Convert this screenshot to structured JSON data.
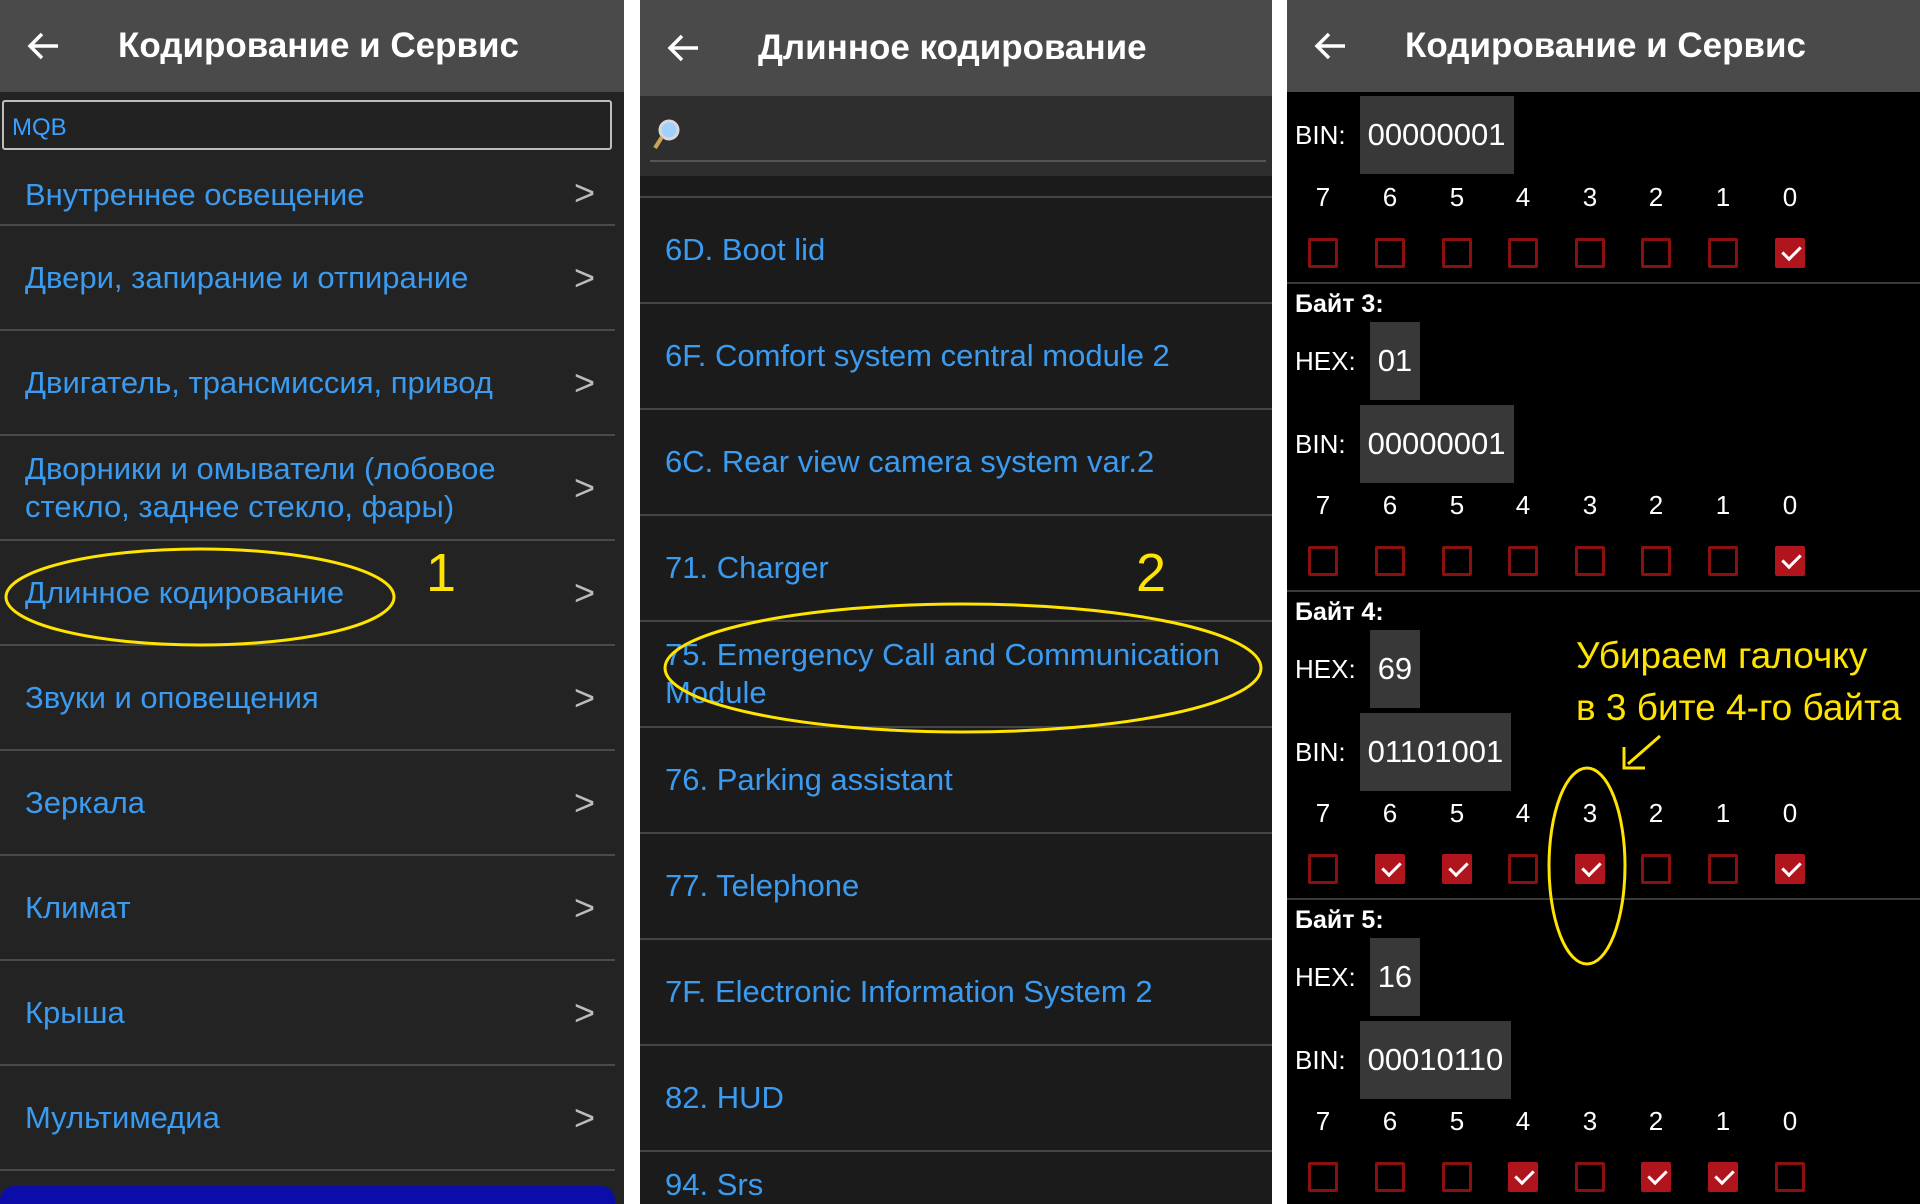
{
  "panel1": {
    "title": "Кодирование и Сервис",
    "filter_value": "MQB",
    "items": [
      "Внутреннее освещение",
      "Двери, запирание и отпирание",
      "Двигатель, трансмиссия, привод",
      "Дворники и омыватели (лобовое стекло, заднее стекло, фары)",
      "Длинное кодирование",
      "Звуки и оповещения",
      "Зеркала",
      "Климат",
      "Крыша",
      "Мультимедиа"
    ],
    "chevron": ">"
  },
  "panel2": {
    "title": "Длинное кодирование",
    "items": [
      "6D. Boot lid",
      "6F. Comfort system central module 2",
      "6C. Rear view camera system var.2",
      "71. Charger",
      "75. Emergency Call and Communication Module",
      "76. Parking assistant",
      "77. Telephone",
      "7F. Electronic Information System 2",
      "82. HUD",
      "94. Srs"
    ]
  },
  "panel3": {
    "title": "Кодирование и Сервис",
    "hex_label": "HEX:",
    "bin_label": "BIN:",
    "bit_numbers": [
      "7",
      "6",
      "5",
      "4",
      "3",
      "2",
      "1",
      "0"
    ],
    "byte2": {
      "bin": "00000001",
      "bits": [
        false,
        false,
        false,
        false,
        false,
        false,
        false,
        true
      ]
    },
    "byte3": {
      "label": "Байт 3:",
      "hex": "01",
      "bin": "00000001",
      "bits": [
        false,
        false,
        false,
        false,
        false,
        false,
        false,
        true
      ]
    },
    "byte4": {
      "label": "Байт 4:",
      "hex": "69",
      "bin": "01101001",
      "bits": [
        false,
        true,
        true,
        false,
        true,
        false,
        false,
        true
      ]
    },
    "byte5": {
      "label": "Байт 5:",
      "hex": "16",
      "bin": "00010110",
      "bits": [
        false,
        false,
        false,
        true,
        false,
        true,
        true,
        false
      ]
    }
  },
  "annotations": {
    "marker1": "1",
    "marker2": "2",
    "note_line1": "Убираем галочку",
    "note_line2": "в 3 бите 4-го байта",
    "color": "#ffe400"
  },
  "colors": {
    "link_blue": "#3a9bf0",
    "checkbox_red": "#b0141c",
    "appbar": "#4a4a4a"
  }
}
